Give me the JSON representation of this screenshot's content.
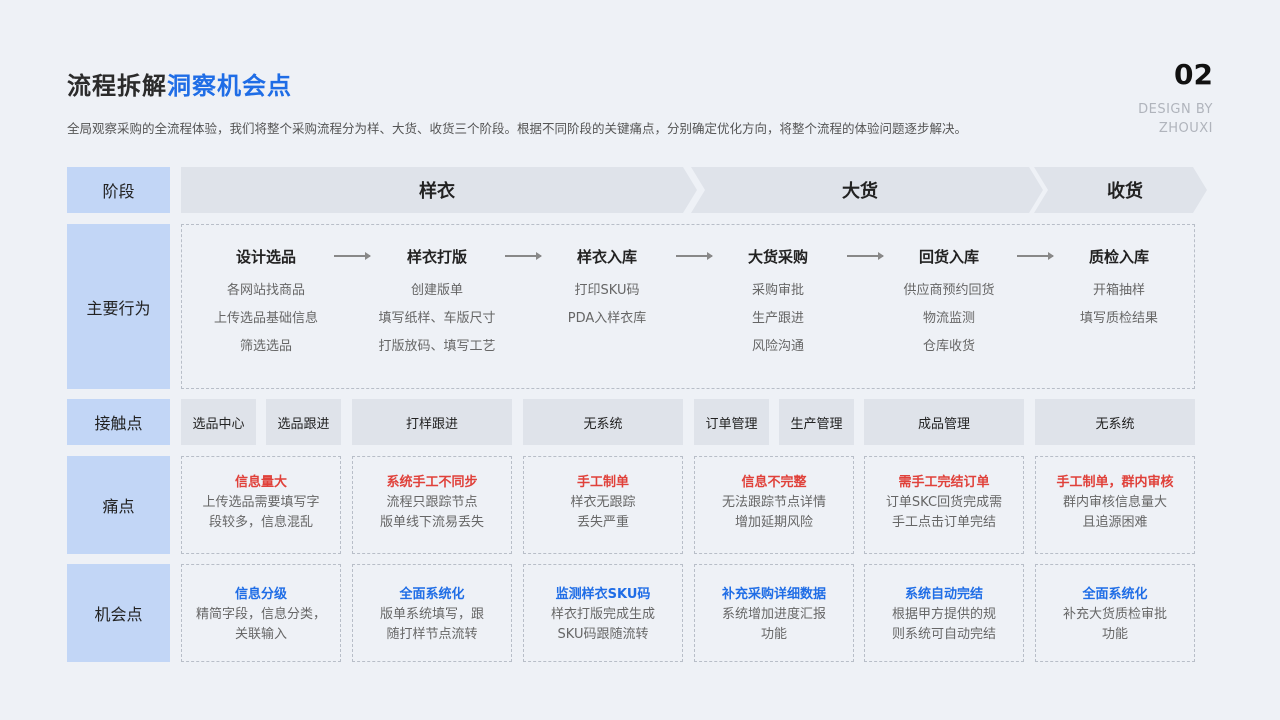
{
  "header": {
    "title_plain": "流程拆解",
    "title_accent": "洞察机会点",
    "subtitle": "全局观察采购的全流程体验，我们将整个采购流程分为样、大货、收货三个阶段。根据不同阶段的关键痛点，分别确定优化方向，将整个流程的体验问题逐步解决。",
    "page_number": "02",
    "credit_line1": "DESIGN BY",
    "credit_line2": "ZHOUXI"
  },
  "row_labels": {
    "stage": "阶段",
    "behavior": "主要行为",
    "touchpoint": "接触点",
    "pain": "痛点",
    "opportunity": "机会点"
  },
  "stages": [
    "样衣",
    "大货",
    "收货"
  ],
  "steps": [
    {
      "title": "设计选品",
      "items": [
        "各网站找商品",
        "上传选品基础信息",
        "筛选选品"
      ]
    },
    {
      "title": "样衣打版",
      "items": [
        "创建版单",
        "填写纸样、车版尺寸",
        "打版放码、填写工艺"
      ]
    },
    {
      "title": "样衣入库",
      "items": [
        "打印SKU码",
        "PDA入样衣库"
      ]
    },
    {
      "title": "大货采购",
      "items": [
        "采购审批",
        "生产跟进",
        "风险沟通"
      ]
    },
    {
      "title": "回货入库",
      "items": [
        "供应商预约回货",
        "物流监测",
        "仓库收货"
      ]
    },
    {
      "title": "质检入库",
      "items": [
        "开箱抽样",
        "填写质检结果"
      ]
    }
  ],
  "touchpoints": [
    "选品中心",
    "选品跟进",
    "打样跟进",
    "无系统",
    "订单管理",
    "生产管理",
    "成品管理",
    "无系统"
  ],
  "pains": [
    {
      "title": "信息量大",
      "lines": [
        "上传选品需要填写字",
        "段较多，信息混乱"
      ]
    },
    {
      "title": "系统手工不同步",
      "lines": [
        "流程只跟踪节点",
        "版单线下流易丢失"
      ]
    },
    {
      "title": "手工制单",
      "lines": [
        "样衣无跟踪",
        "丢失严重"
      ]
    },
    {
      "title": "信息不完整",
      "lines": [
        "无法跟踪节点详情",
        "增加延期风险"
      ]
    },
    {
      "title": "需手工完结订单",
      "lines": [
        "订单SKC回货完成需",
        "手工点击订单完结"
      ]
    },
    {
      "title": "手工制单，群内审核",
      "lines": [
        "群内审核信息量大",
        "且追源困难"
      ]
    }
  ],
  "opportunities": [
    {
      "title": "信息分级",
      "lines": [
        "精简字段，信息分类，",
        "关联输入"
      ]
    },
    {
      "title": "全面系统化",
      "lines": [
        "版单系统填写，跟",
        "随打样节点流转"
      ]
    },
    {
      "title": "监测样衣SKU码",
      "lines": [
        "样衣打版完成生成",
        "SKU码跟随流转"
      ]
    },
    {
      "title": "补充采购详细数据",
      "lines": [
        "系统增加进度汇报",
        "功能"
      ]
    },
    {
      "title": "系统自动完结",
      "lines": [
        "根据甲方提供的规",
        "则系统可自动完结"
      ]
    },
    {
      "title": "全面系统化",
      "lines": [
        "补充大货质检审批",
        "功能"
      ]
    }
  ],
  "colors": {
    "accent": "#1f6de6",
    "pain": "#e0413a",
    "label_bg": "#c2d6f6",
    "stage_bg": "#dfe3ea"
  }
}
